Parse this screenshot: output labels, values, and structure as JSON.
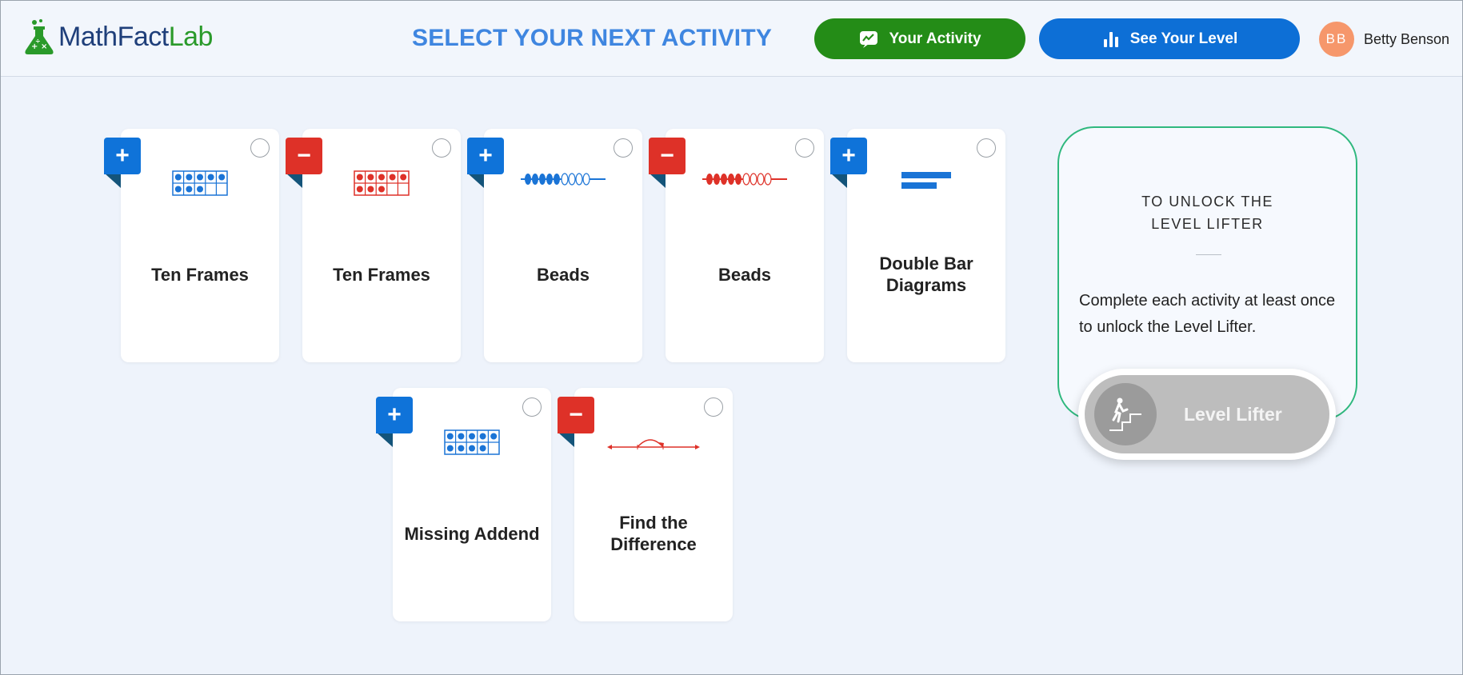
{
  "header": {
    "logo_part1": "MathFact",
    "logo_part2": "Lab",
    "title": "SELECT YOUR NEXT ACTIVITY",
    "activity_button": "Your Activity",
    "level_button": "See Your Level",
    "user_initials": "BB",
    "user_name": "Betty Benson"
  },
  "activities": [
    {
      "label": "Ten Frames",
      "operation": "plus",
      "visual": "ten-frame-icon",
      "color": "#1a74d6"
    },
    {
      "label": "Ten Frames",
      "operation": "minus",
      "visual": "ten-frame-icon",
      "color": "#de3128"
    },
    {
      "label": "Beads",
      "operation": "plus",
      "visual": "beads-icon",
      "color": "#1a74d6"
    },
    {
      "label": "Beads",
      "operation": "minus",
      "visual": "beads-icon",
      "color": "#de3128"
    },
    {
      "label": "Double Bar Diagrams",
      "operation": "plus",
      "visual": "bar-diagram-icon",
      "color": "#1a74d6"
    },
    {
      "label": "Missing Addend",
      "operation": "plus",
      "visual": "ten-frame-icon",
      "color": "#1a74d6"
    },
    {
      "label": "Find the Difference",
      "operation": "minus",
      "visual": "number-line-icon",
      "color": "#de3128"
    }
  ],
  "unlock": {
    "title_line1": "TO UNLOCK THE",
    "title_line2": "LEVEL LIFTER",
    "description": "Complete each activity at least once to unlock the Level Lifter.",
    "button_label": "Level Lifter"
  },
  "colors": {
    "accent_blue": "#0d6fd6",
    "accent_green": "#248c17",
    "minus_red": "#de3128",
    "panel_border": "#2fb87e"
  }
}
